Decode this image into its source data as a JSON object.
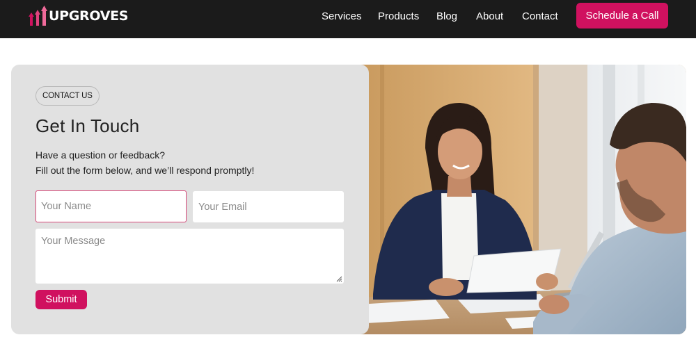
{
  "nav": {
    "brand": "UPGROVES",
    "links": [
      {
        "label": "Services"
      },
      {
        "label": "Products"
      },
      {
        "label": "Blog"
      },
      {
        "label": "About"
      },
      {
        "label": "Contact"
      }
    ],
    "cta_label": "Schedule a Call"
  },
  "contact": {
    "badge": "CONTACT US",
    "title": "Get In Touch",
    "subtitle_line1": "Have a question or feedback?",
    "subtitle_line2": "Fill out the form below, and we’ll respond promptly!",
    "name_placeholder": "Your Name",
    "name_value": "",
    "email_placeholder": "Your Email",
    "email_value": "",
    "message_placeholder": "Your Message",
    "message_value": "",
    "submit_label": "Submit"
  },
  "photo": {
    "icon": "office-meeting-photo"
  },
  "colors": {
    "accent": "#d0115f",
    "nav_bg": "#1b1b1b",
    "panel_bg": "#e1e1e1"
  }
}
